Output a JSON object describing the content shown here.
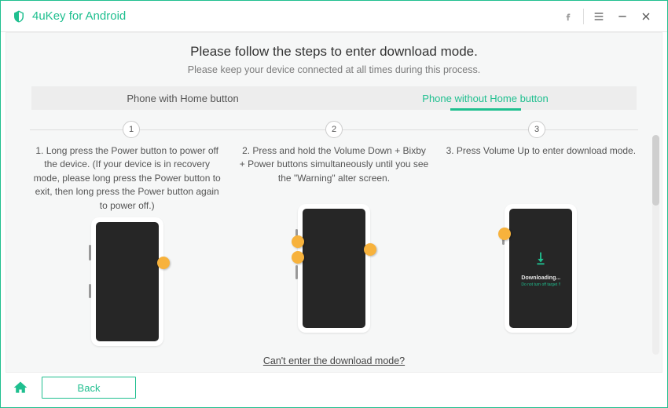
{
  "app": {
    "title": "4uKey for Android"
  },
  "main": {
    "headline": "Please follow the steps to enter download mode.",
    "subhead": "Please keep your device connected at all times during this process.",
    "tabs": [
      {
        "label": "Phone with Home button",
        "active": false
      },
      {
        "label": "Phone without Home button",
        "active": true
      }
    ],
    "steps": [
      {
        "num": "1",
        "text": "1. Long press the Power button to power off the device. (If your device is in recovery mode, please long press the Power button to exit, then long press the Power button again to power off.)"
      },
      {
        "num": "2",
        "text": "2. Press and hold the Volume Down + Bixby + Power buttons simultaneously until you see the \"Warning\" alter screen."
      },
      {
        "num": "3",
        "text": "3. Press Volume Up to enter download mode."
      }
    ],
    "phone3": {
      "status": "Downloading...",
      "warning": "Do not turn off target !!"
    },
    "help_link": "Can't enter the download mode?"
  },
  "footer": {
    "back_label": "Back"
  },
  "colors": {
    "accent": "#1fbf8f"
  }
}
